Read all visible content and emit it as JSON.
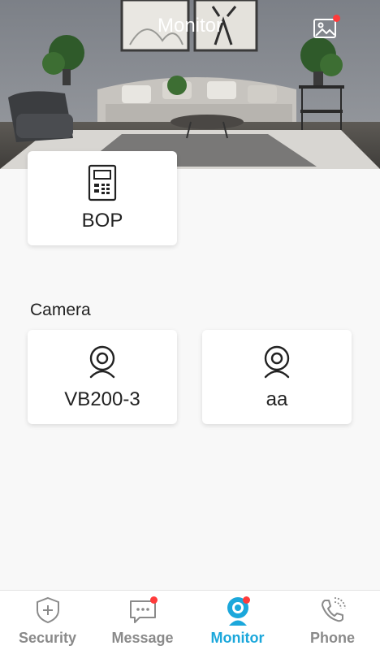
{
  "header": {
    "title": "Monitor",
    "gallery_icon": "image-gallery-icon",
    "gallery_badge_color": "#ff3b3b"
  },
  "devices": [
    {
      "name": "BOP",
      "icon": "door-station-icon"
    }
  ],
  "camera_section": {
    "label": "Camera",
    "cameras": [
      {
        "name": "VB200-3",
        "icon": "webcam-icon"
      },
      {
        "name": "aa",
        "icon": "webcam-icon"
      }
    ]
  },
  "tabs": [
    {
      "label": "Security",
      "icon": "shield-plus-icon",
      "active": false,
      "badge": false
    },
    {
      "label": "Message",
      "icon": "chat-bubble-icon",
      "active": false,
      "badge": true
    },
    {
      "label": "Monitor",
      "icon": "camera-icon",
      "active": true,
      "badge": true
    },
    {
      "label": "Phone",
      "icon": "phone-icon",
      "active": false,
      "badge": false
    }
  ],
  "colors": {
    "accent": "#1ba7db",
    "inactive": "#8a8a8a",
    "badge": "#ff3b3b"
  }
}
